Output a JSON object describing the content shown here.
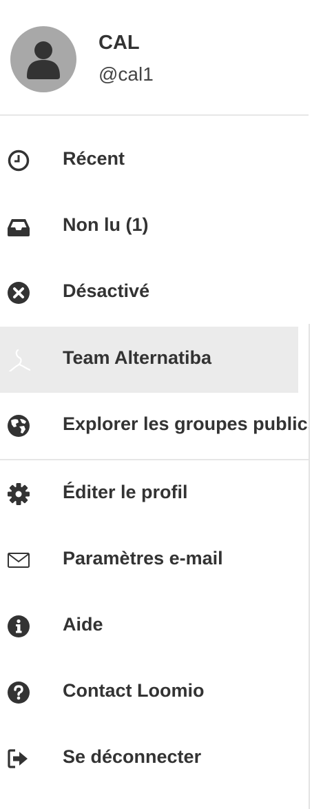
{
  "profile": {
    "name": "CAL",
    "handle": "@cal1",
    "avatar_icon": "user-silhouette-icon",
    "avatar_color": "#a8a8a8"
  },
  "menu": {
    "recent": {
      "label": "Récent",
      "icon": "clock-icon"
    },
    "unread": {
      "label": "Non lu (1)",
      "icon": "inbox-icon"
    },
    "muted": {
      "label": "Désactivé",
      "icon": "circle-x-icon"
    },
    "group": {
      "label": "Team Alternatiba",
      "icon": "group-logo-icon",
      "active": true
    },
    "explore": {
      "label": "Explorer les groupes publics",
      "icon": "globe-icon"
    },
    "edit_profile": {
      "label": "Éditer le profil",
      "icon": "gear-icon"
    },
    "email_settings": {
      "label": "Paramètres e-mail",
      "icon": "envelope-icon"
    },
    "help": {
      "label": "Aide",
      "icon": "info-icon"
    },
    "contact": {
      "label": "Contact Loomio",
      "icon": "question-icon"
    },
    "sign_out": {
      "label": "Se déconnecter",
      "icon": "sign-out-icon"
    }
  },
  "colors": {
    "text": "#333333",
    "active_background": "#ebebeb",
    "divider": "#e6e6e6"
  }
}
